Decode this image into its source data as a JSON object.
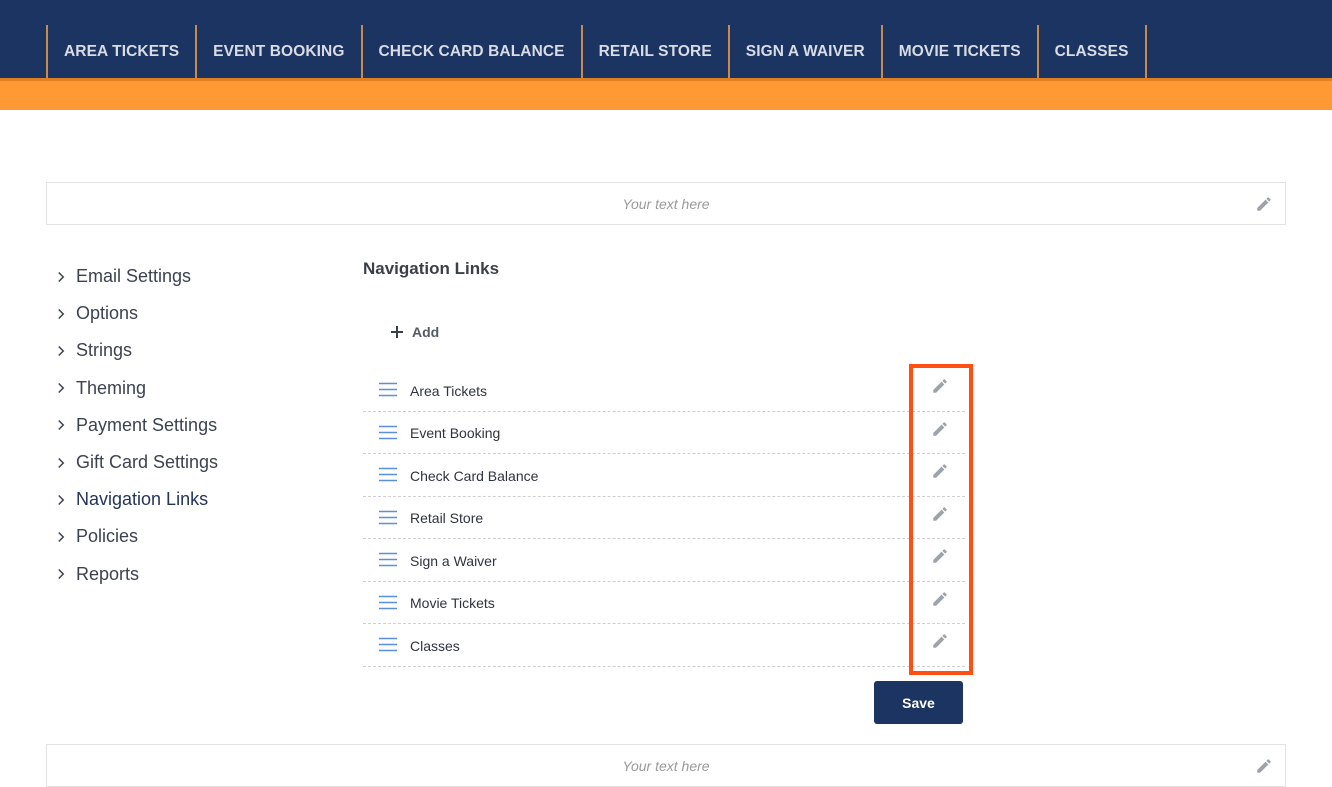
{
  "top_nav": {
    "items": [
      "AREA TICKETS",
      "EVENT BOOKING",
      "CHECK CARD BALANCE",
      "RETAIL STORE",
      "SIGN A WAIVER",
      "MOVIE TICKETS",
      "CLASSES"
    ]
  },
  "banners": {
    "top_text": "Your text here",
    "bottom_text": "Your text here"
  },
  "sidebar": {
    "items": [
      {
        "label": "Email Settings"
      },
      {
        "label": "Options"
      },
      {
        "label": "Strings"
      },
      {
        "label": "Theming"
      },
      {
        "label": "Payment Settings"
      },
      {
        "label": "Gift Card Settings"
      },
      {
        "label": "Navigation Links"
      },
      {
        "label": "Policies"
      },
      {
        "label": "Reports"
      }
    ]
  },
  "main": {
    "title": "Navigation Links",
    "add_label": "Add",
    "links": [
      "Area Tickets",
      "Event Booking",
      "Check Card Balance",
      "Retail Store",
      "Sign a Waiver",
      "Movie Tickets",
      "Classes"
    ],
    "save_label": "Save"
  },
  "colors": {
    "nav_bg": "#1c3461",
    "accent_orange": "#ff9933",
    "highlight": "#ff4f12",
    "drag_icon": "#5b8fd6"
  }
}
